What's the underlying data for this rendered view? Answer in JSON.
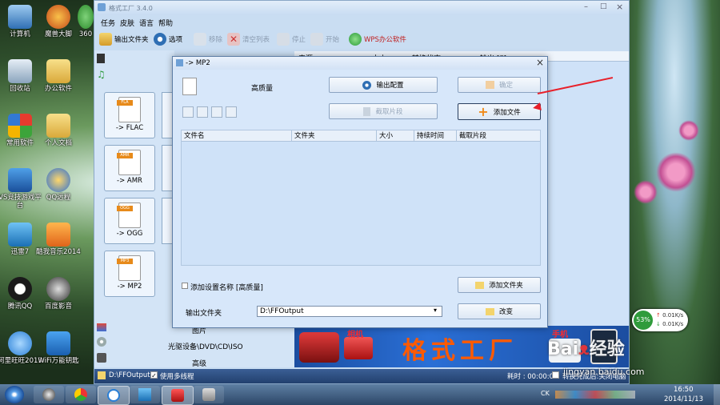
{
  "desktop": {
    "icons": [
      {
        "label": "计算机"
      },
      {
        "label": "魔兽大脚"
      },
      {
        "label": "360"
      },
      {
        "label": "回收站"
      },
      {
        "label": "办公软件"
      },
      {
        "label": "常用软件"
      },
      {
        "label": "个人文档"
      },
      {
        "label": "VS竞技游戏平台"
      },
      {
        "label": "QQ远程"
      },
      {
        "label": "迅雷7"
      },
      {
        "label": "酷我音乐2014"
      },
      {
        "label": "腾讯QQ"
      },
      {
        "label": "百度影音"
      },
      {
        "label": "阿里旺旺2013"
      },
      {
        "label": "WiFi万能钥匙"
      }
    ],
    "net_widget": {
      "percent": "53%",
      "up": "0.01K/s",
      "down": "0.01K/s"
    },
    "watermark": {
      "site": "jingyan.baidu.com"
    }
  },
  "app": {
    "title": "格式工厂 3.4.0",
    "menu": [
      "任务",
      "皮肤",
      "语言",
      "帮助"
    ],
    "toolbar": [
      {
        "label": "输出文件夹",
        "enabled": true
      },
      {
        "label": "选项",
        "enabled": true
      },
      {
        "label": "移除",
        "enabled": false
      },
      {
        "label": "清空列表",
        "enabled": false
      },
      {
        "label": "停止",
        "enabled": false
      },
      {
        "label": "开始",
        "enabled": false
      },
      {
        "label": "WPS办公软件",
        "enabled": true
      }
    ],
    "list_headers": [
      "来源",
      "大小",
      "转换状态",
      "输出 [F]"
    ],
    "formats": [
      {
        "tag": "FLA",
        "label": "-> FLAC"
      },
      {
        "tag": "AMR",
        "label": "-> AMR"
      },
      {
        "tag": "OGG",
        "label": "-> OGG"
      },
      {
        "tag": "MP3",
        "label": "-> MP2"
      }
    ],
    "left_bottom": [
      "图片",
      "光驱设备\\DVD\\CD\\ISO",
      "高级"
    ],
    "banner": {
      "text": "格式工厂",
      "camera_label": "相机",
      "phone_label": "手机"
    },
    "statusbar": {
      "path": "D:\\FFOutput",
      "multithread": "使用多线程",
      "elapsed": "耗时 : 00:00:00",
      "finished": "转换完成后:关闭电脑"
    }
  },
  "dialog": {
    "title": "-> MP2",
    "quality": "高质量",
    "output_config": "输出配置",
    "confirm": "确定",
    "clip": "截取片段",
    "add_file": "添加文件",
    "columns": [
      "文件名",
      "文件夹",
      "大小",
      "持续时间",
      "截取片段"
    ],
    "add_setting_label": "添加设置名称 [高质量]",
    "add_folder": "添加文件夹",
    "output_folder_label": "输出文件夹",
    "output_folder_value": "D:\\FFOutput",
    "change": "改变"
  },
  "taskbar": {
    "time": "16:50",
    "date": "2014/11/13",
    "lang": "CK"
  }
}
